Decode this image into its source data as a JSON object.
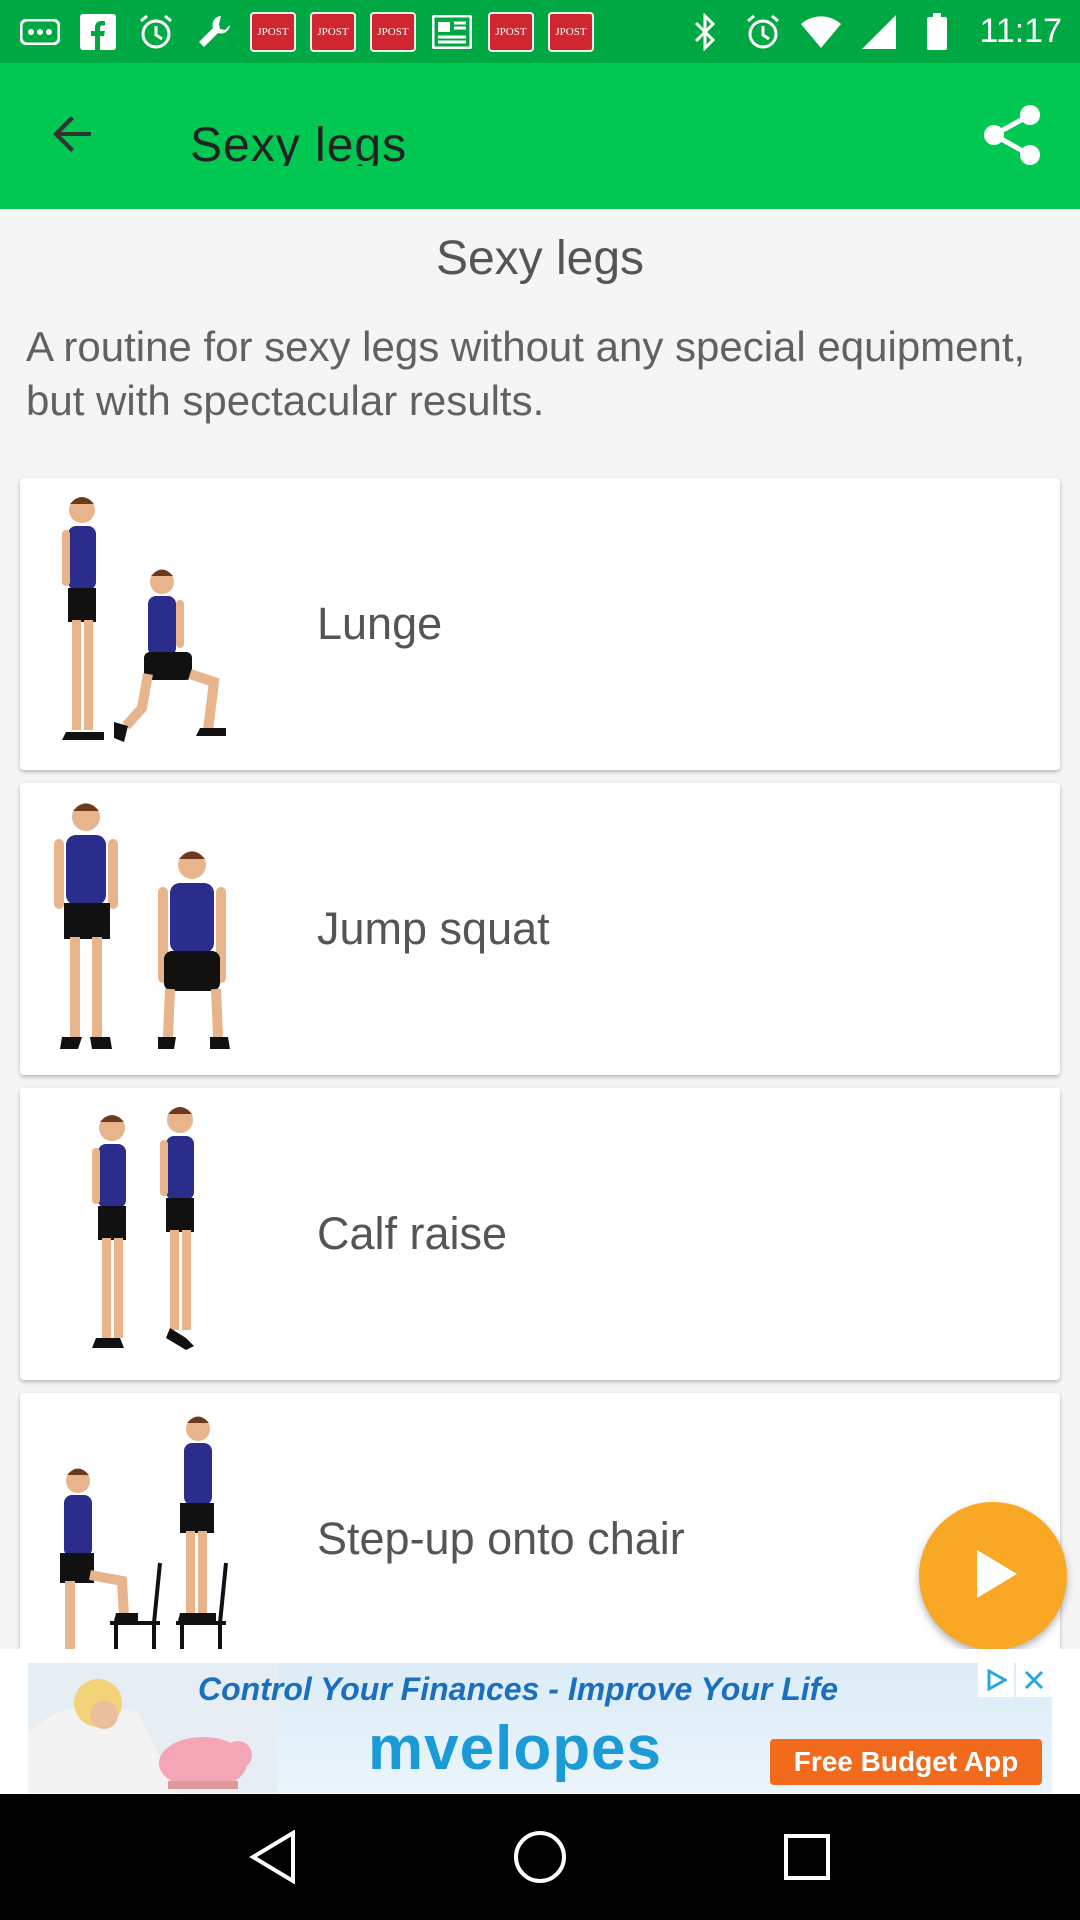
{
  "status_bar": {
    "time": "11:17",
    "post_badge": "JPOST",
    "icons": [
      "more-icon",
      "facebook-icon",
      "alarm-icon",
      "wrench-icon",
      "jpost-icon",
      "jpost-icon",
      "jpost-icon",
      "news-icon",
      "jpost-icon",
      "jpost-icon",
      "bluetooth-icon",
      "alarm-icon",
      "wifi-icon",
      "signal-icon",
      "battery-icon"
    ]
  },
  "app_bar": {
    "title": "Sexy legs",
    "back_icon": "arrow-back-icon",
    "share_icon": "share-icon",
    "color": "#00c853"
  },
  "page": {
    "title": "Sexy legs",
    "description": "A routine for sexy legs without any special equipment, but with spectacular results."
  },
  "exercises": [
    {
      "label": "Lunge",
      "icon": "lunge-figure"
    },
    {
      "label": "Jump squat",
      "icon": "squat-figure"
    },
    {
      "label": "Calf raise",
      "icon": "calf-raise-figure"
    },
    {
      "label": "Step-up onto chair",
      "icon": "step-up-figure"
    }
  ],
  "fab": {
    "icon": "play-icon",
    "color": "#f9a825"
  },
  "ad": {
    "headline": "Control Your Finances - Improve Your Life",
    "brand": "mvelopes",
    "cta": "Free Budget App"
  },
  "nav": [
    "back-nav-icon",
    "home-nav-icon",
    "recents-nav-icon"
  ]
}
